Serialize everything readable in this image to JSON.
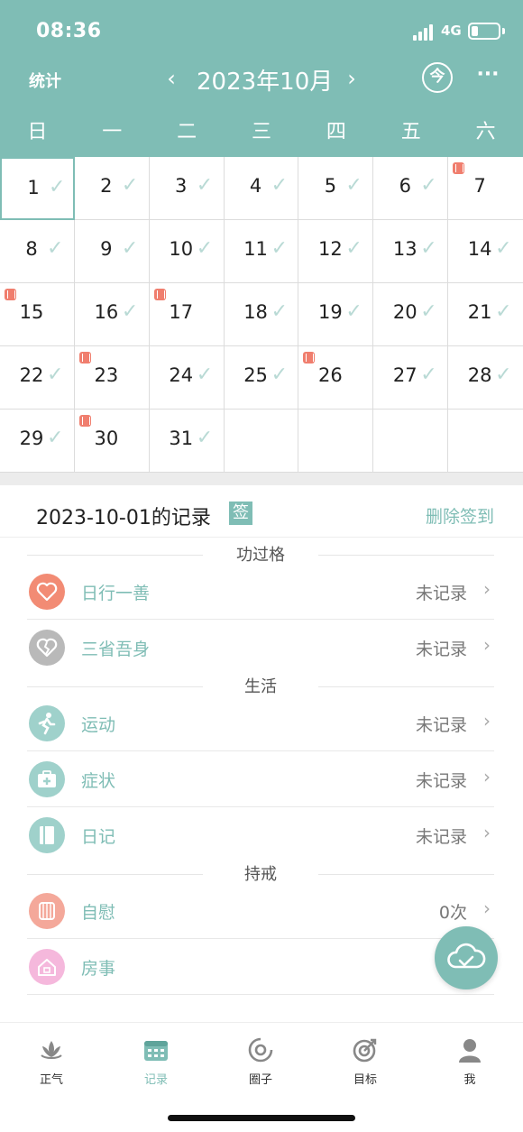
{
  "status_bar": {
    "time": "08:36",
    "network": "4G",
    "battery_percent": 25
  },
  "header": {
    "stats_label": "统计",
    "prev_label": "‹",
    "month_title": "2023年10月",
    "next_label": "›",
    "today_label": "今",
    "more_label": "···",
    "weekdays": [
      "日",
      "一",
      "二",
      "三",
      "四",
      "五",
      "六"
    ]
  },
  "calendar": {
    "leading_blank_days": 0,
    "days": [
      {
        "day": "1",
        "checked": true,
        "marker": false,
        "selected": true
      },
      {
        "day": "2",
        "checked": true,
        "marker": false
      },
      {
        "day": "3",
        "checked": true,
        "marker": false
      },
      {
        "day": "4",
        "checked": true,
        "marker": false
      },
      {
        "day": "5",
        "checked": true,
        "marker": false
      },
      {
        "day": "6",
        "checked": true,
        "marker": false
      },
      {
        "day": "7",
        "checked": false,
        "marker": true
      },
      {
        "day": "8",
        "checked": true,
        "marker": false
      },
      {
        "day": "9",
        "checked": true,
        "marker": false
      },
      {
        "day": "10",
        "checked": true,
        "marker": false
      },
      {
        "day": "11",
        "checked": true,
        "marker": false
      },
      {
        "day": "12",
        "checked": true,
        "marker": false
      },
      {
        "day": "13",
        "checked": true,
        "marker": false
      },
      {
        "day": "14",
        "checked": true,
        "marker": false
      },
      {
        "day": "15",
        "checked": false,
        "marker": true
      },
      {
        "day": "16",
        "checked": true,
        "marker": false
      },
      {
        "day": "17",
        "checked": false,
        "marker": true
      },
      {
        "day": "18",
        "checked": true,
        "marker": false
      },
      {
        "day": "19",
        "checked": true,
        "marker": false
      },
      {
        "day": "20",
        "checked": true,
        "marker": false
      },
      {
        "day": "21",
        "checked": true,
        "marker": false
      },
      {
        "day": "22",
        "checked": true,
        "marker": false
      },
      {
        "day": "23",
        "checked": false,
        "marker": true
      },
      {
        "day": "24",
        "checked": true,
        "marker": false
      },
      {
        "day": "25",
        "checked": true,
        "marker": false
      },
      {
        "day": "26",
        "checked": false,
        "marker": true
      },
      {
        "day": "27",
        "checked": true,
        "marker": false
      },
      {
        "day": "28",
        "checked": true,
        "marker": false
      },
      {
        "day": "29",
        "checked": true,
        "marker": false
      },
      {
        "day": "30",
        "checked": false,
        "marker": true
      },
      {
        "day": "31",
        "checked": true,
        "marker": false
      }
    ],
    "check_glyph": "✓"
  },
  "record": {
    "title": "2023-10-01的记录",
    "sign_badge": "签",
    "delete_label": "删除签到"
  },
  "sections": {
    "merit": {
      "title": "功过格",
      "items": [
        {
          "label": "日行一善",
          "value": "未记录",
          "chevron": "›",
          "icon": "heart-icon",
          "color": "#f28b74"
        },
        {
          "label": "三省吾身",
          "value": "未记录",
          "chevron": "›",
          "icon": "broken-heart-icon",
          "color": "#b9b9b9"
        }
      ]
    },
    "life": {
      "title": "生活",
      "items": [
        {
          "label": "运动",
          "value": "未记录",
          "chevron": "›",
          "icon": "running-icon",
          "color": "#9fd1cb"
        },
        {
          "label": "症状",
          "value": "未记录",
          "chevron": "›",
          "icon": "medkit-icon",
          "color": "#9fd1cb"
        },
        {
          "label": "日记",
          "value": "未记录",
          "chevron": "›",
          "icon": "notebook-icon",
          "color": "#9fd1cb"
        }
      ]
    },
    "abstain": {
      "title": "持戒",
      "items": [
        {
          "label": "自慰",
          "value": "0次",
          "chevron": "›",
          "icon": "tissue-icon",
          "color": "#f4a89a"
        },
        {
          "label": "房事",
          "value": "",
          "chevron": "",
          "icon": "house-icon",
          "color": "#f5b8dc"
        }
      ]
    }
  },
  "tabbar": {
    "tabs": [
      {
        "label": "正气",
        "icon": "lotus-icon"
      },
      {
        "label": "记录",
        "icon": "calendar-icon",
        "active": true
      },
      {
        "label": "圈子",
        "icon": "circle-icon"
      },
      {
        "label": "目标",
        "icon": "target-icon"
      },
      {
        "label": "我",
        "icon": "person-icon"
      }
    ]
  },
  "colors": {
    "accent": "#7fbdb5",
    "marker": "#f07e6e",
    "check": "#b9dad5"
  }
}
